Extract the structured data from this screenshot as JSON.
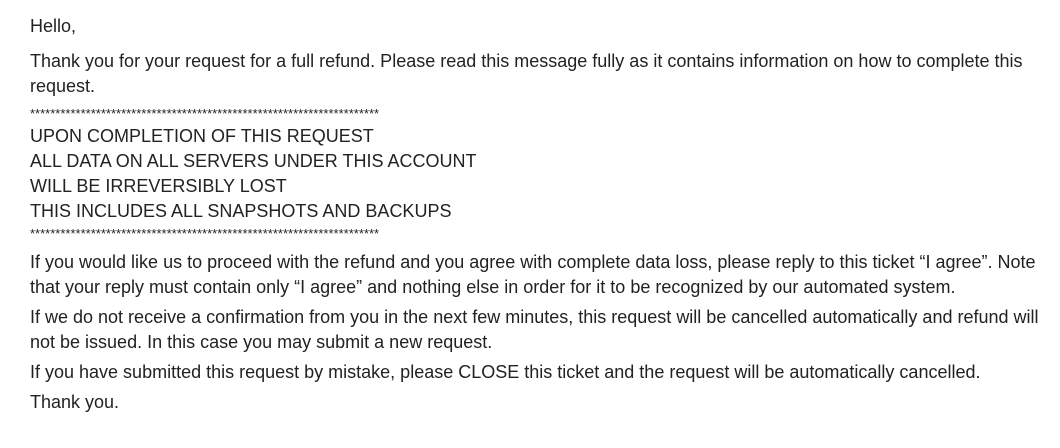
{
  "message": {
    "greeting": "Hello,",
    "intro": "Thank you for your request for a full refund. Please read this message fully as it contains information on how to complete this request.",
    "separator": "*********************************************************************",
    "warning_lines": [
      "UPON COMPLETION OF THIS REQUEST",
      "ALL DATA ON ALL SERVERS UNDER THIS ACCOUNT",
      "WILL BE IRREVERSIBLY LOST",
      "THIS INCLUDES ALL SNAPSHOTS AND BACKUPS"
    ],
    "proceed": "If you would like us to proceed with the refund and you agree with complete data loss, please reply to this ticket “I agree”. Note that your reply must contain only “I agree” and nothing else in order for it to be recognized by our automated system.",
    "timeout": "If we do not receive a confirmation from you in the next few minutes, this request will be cancelled automatically and refund will not be issued. In this case you may submit a new request.",
    "mistake": "If you have submitted this request by mistake, please CLOSE this ticket and the request will be automatically cancelled.",
    "closing": "Thank you."
  }
}
